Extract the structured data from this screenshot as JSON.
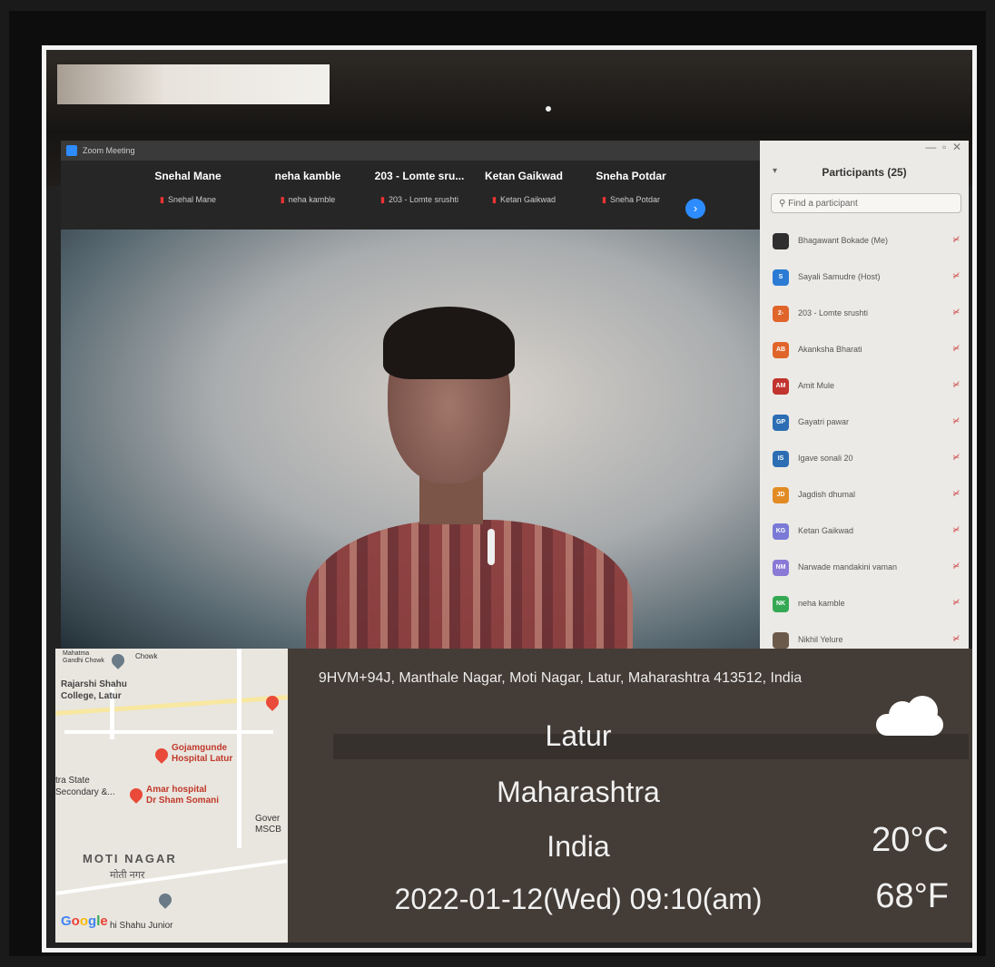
{
  "zoom": {
    "window_title": "Zoom Meeting",
    "gallery": [
      {
        "name": "Snehal Mane",
        "sub": "Snehal Mane"
      },
      {
        "name": "neha kamble",
        "sub": "neha kamble"
      },
      {
        "name": "203 - Lomte sru...",
        "sub": "203 - Lomte srushti"
      },
      {
        "name": "Ketan Gaikwad",
        "sub": "Ketan Gaikwad"
      },
      {
        "name": "Sneha Potdar",
        "sub": "Sneha Potdar"
      }
    ],
    "next_icon": "chevron-right-icon",
    "participants": {
      "title": "Participants (25)",
      "search_placeholder": "Find a participant",
      "list": [
        {
          "initials": "",
          "name": "Bhagawant Bokade (Me)",
          "color": "#2f2f2f"
        },
        {
          "initials": "S",
          "name": "Sayali Samudre (Host)",
          "color": "#2b7bd5"
        },
        {
          "initials": "2-",
          "name": "203 - Lomte srushti",
          "color": "#e0652b"
        },
        {
          "initials": "AB",
          "name": "Akanksha Bharati",
          "color": "#e0652b"
        },
        {
          "initials": "AM",
          "name": "Amit Mule",
          "color": "#c2342f"
        },
        {
          "initials": "GP",
          "name": "Gayatri pawar",
          "color": "#2c6db3"
        },
        {
          "initials": "IS",
          "name": "Igave sonali 20",
          "color": "#2c6db3"
        },
        {
          "initials": "JD",
          "name": "Jagdish dhumal",
          "color": "#e28b24"
        },
        {
          "initials": "KG",
          "name": "Ketan Gaikwad",
          "color": "#7a7ad6"
        },
        {
          "initials": "NM",
          "name": "Narwade mandakini vaman",
          "color": "#8a7ad6"
        },
        {
          "initials": "NK",
          "name": "neha kamble",
          "color": "#34a853"
        },
        {
          "initials": "",
          "name": "Nikhil Yelure",
          "color": "#6b5a4a"
        }
      ]
    }
  },
  "overlay": {
    "address": "9HVM+94J, Manthale Nagar, Moti Nagar, Latur, Maharashtra 413512, India",
    "city": "Latur",
    "state": "Maharashtra",
    "country": "India",
    "datetime": "2022-01-12(Wed)  09:10(am)",
    "temp_c": "20°C",
    "temp_f": "68°F",
    "weather_icon": "cloud-icon"
  },
  "map": {
    "labels": {
      "gandhi_chowk": "Mahatma Gandhi Chowk",
      "chowk": "Chowk",
      "college_1": "Rajarshi Shahu",
      "college_2": "College, Latur",
      "hospital1_a": "Gojamgunde",
      "hospital1_b": "Hospital Latur",
      "hospital2_a": "Amar hospital",
      "hospital2_b": "Dr Sham Somani",
      "state_1": "tra State",
      "state_2": "Secondary &...",
      "gov_1": "Gover",
      "gov_2": "MSCB",
      "moti_nagar": "MOTI NAGAR",
      "moti_nagar_local": "मोती नगर",
      "shahu_junior": "hi Shahu Junior",
      "google": "Google"
    }
  }
}
